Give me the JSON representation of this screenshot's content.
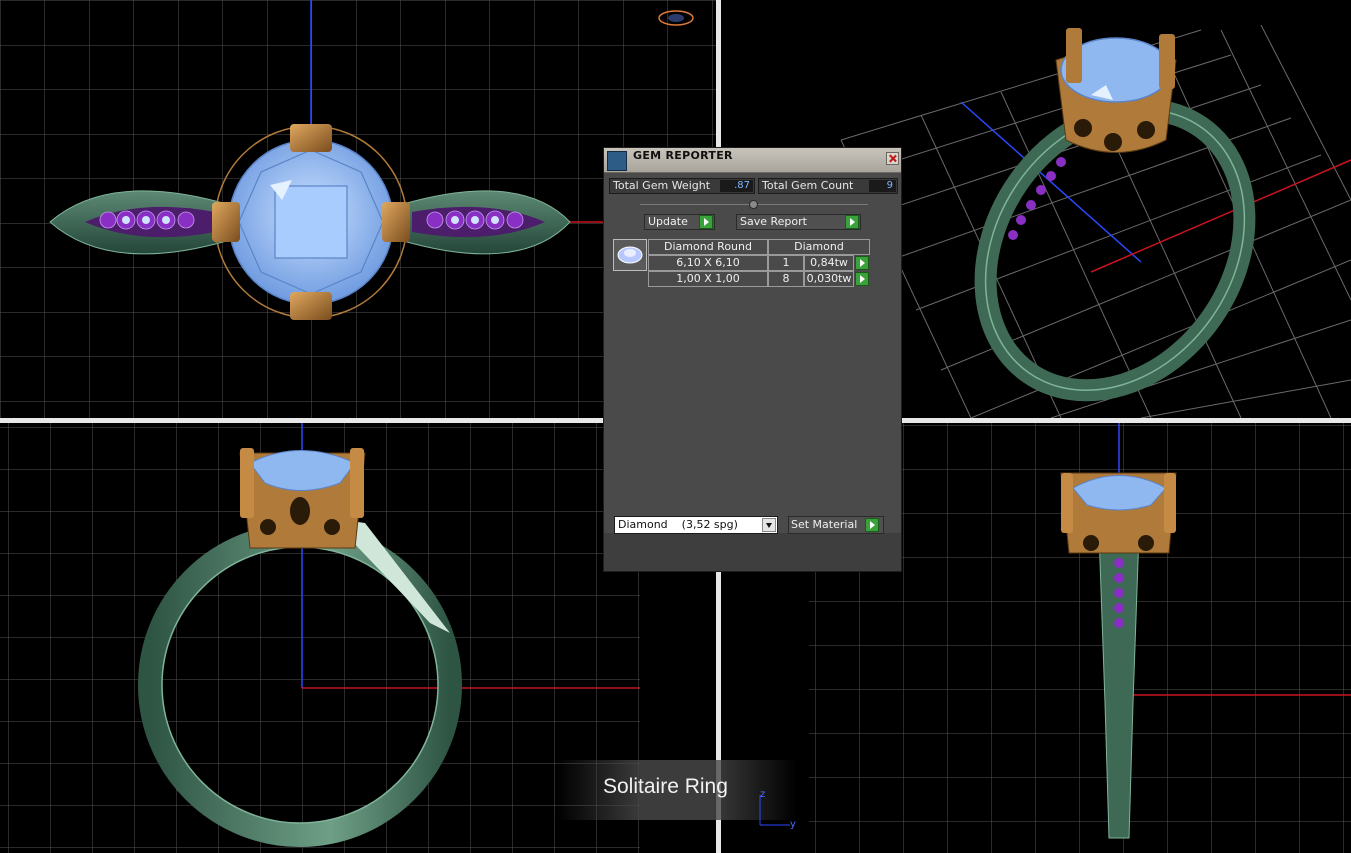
{
  "gem_reporter": {
    "title": "GEM REPORTER",
    "total_weight_label": "Total Gem Weight",
    "total_weight_value": ".87",
    "total_count_label": "Total Gem Count",
    "total_count_value": "9",
    "update_label": "Update",
    "save_report_label": "Save Report",
    "table_headers": {
      "shape": "Diamond Round",
      "material": "Diamond"
    },
    "rows": [
      {
        "size": "6,10 X 6,10",
        "count": "1",
        "weight": "0,84tw"
      },
      {
        "size": "1,00 X 1,00",
        "count": "8",
        "weight": "0,030tw"
      }
    ],
    "material_select_value": "Diamond    (3,52 spg)",
    "set_material_label": "Set Material"
  },
  "caption": "Solitaire Ring",
  "axis_labels": {
    "z": "z",
    "y": "y"
  },
  "colors": {
    "gem": "#8fb8f0",
    "band": "#3e6a55",
    "prong": "#b07a3a",
    "accent_gems": "#8a2fc4",
    "grid": "#5a5a5a",
    "axis_blue": "#2b48ff",
    "axis_red": "#c8141e"
  }
}
